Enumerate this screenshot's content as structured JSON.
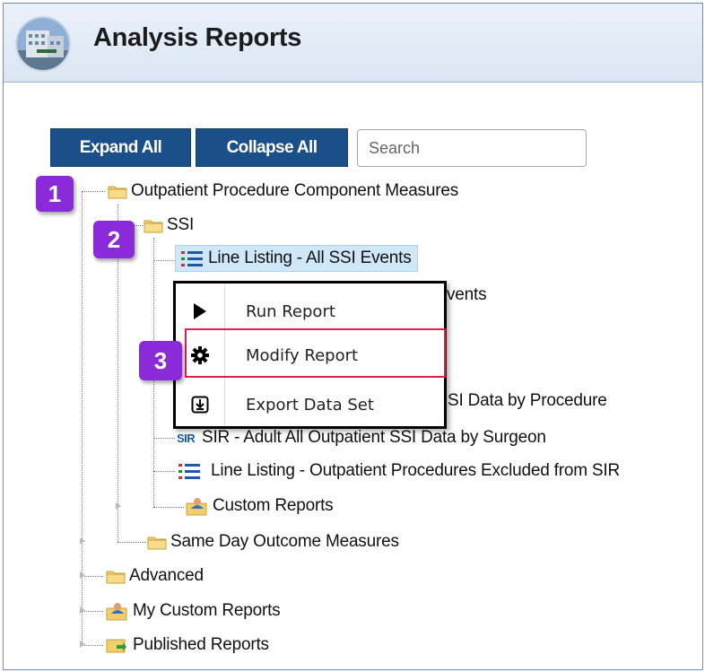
{
  "header": {
    "title": "Analysis Reports"
  },
  "toolbar": {
    "expand_label": "Expand All",
    "collapse_label": "Collapse All",
    "search_placeholder": "Search"
  },
  "tree": {
    "outpatient": "Outpatient Procedure Component Measures",
    "ssi": "SSI",
    "line_all_ssi": "Line Listing - All SSI Events",
    "hidden_partial": "vents",
    "sir_procedure_partial": "SI Data by Procedure",
    "sir_prefix": "SIR",
    "sir_surgeon": "SIR - Adult All Outpatient SSI Data by Surgeon",
    "line_excluded": "Line Listing - Outpatient Procedures Excluded from SIR",
    "custom_reports": "Custom Reports",
    "same_day": "Same Day Outcome Measures",
    "advanced": "Advanced",
    "my_custom": "My Custom Reports",
    "published": "Published Reports"
  },
  "context_menu": {
    "run": "Run Report",
    "modify": "Modify Report",
    "export": "Export Data Set"
  },
  "badges": {
    "b1": "1",
    "b2": "2",
    "b3": "3"
  },
  "colors": {
    "button_bg": "#1b4f8a",
    "badge": "#8a2ad8",
    "highlight_border": "#e0204a",
    "selected_bg": "#cfe7f8"
  }
}
